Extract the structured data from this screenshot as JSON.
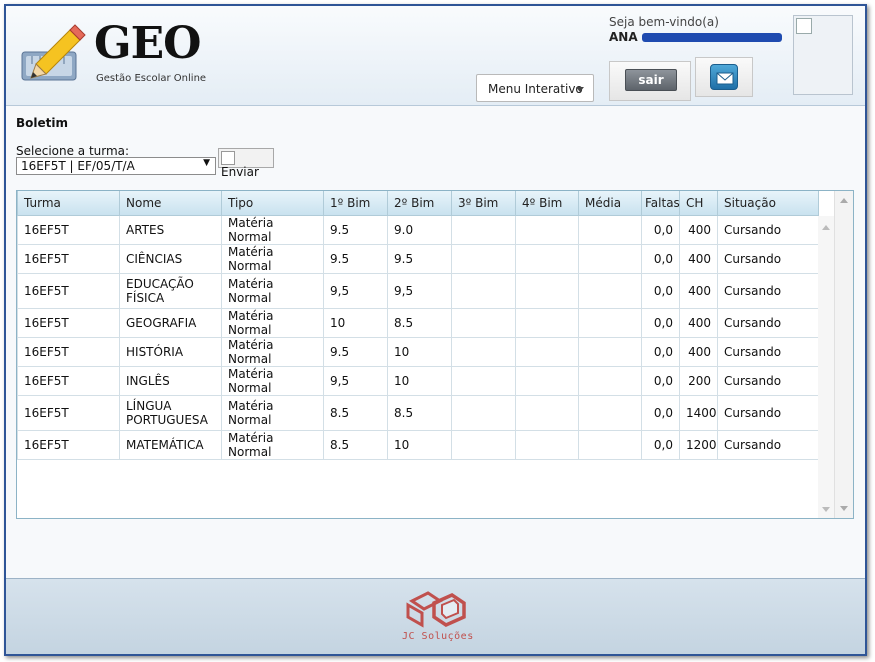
{
  "header": {
    "logo_title": "GEO",
    "logo_subtitle": "Gestão Escolar Online",
    "welcome": "Seja bem-vindo(a)",
    "user_first_name": "ANA",
    "menu_label": "Menu Interativo",
    "logout_label": "sair"
  },
  "boletim": {
    "title": "Boletim",
    "select_label": "Selecione a turma:",
    "selected_turma": "16EF5T | EF/05/T/A",
    "submit_label": "Enviar"
  },
  "table": {
    "columns": [
      "Turma",
      "Nome",
      "Tipo",
      "1º Bim",
      "2º Bim",
      "3º Bim",
      "4º Bim",
      "Média",
      "Faltas",
      "CH",
      "Situação"
    ],
    "rows": [
      {
        "turma": "16EF5T",
        "nome": "ARTES",
        "tipo": "Matéria Normal",
        "b1": "9.5",
        "b2": "9.0",
        "b3": "",
        "b4": "",
        "media": "",
        "faltas": "0,0",
        "ch": "400",
        "situacao": "Cursando"
      },
      {
        "turma": "16EF5T",
        "nome": "CIÊNCIAS",
        "tipo": "Matéria Normal",
        "b1": "9.5",
        "b2": "9.5",
        "b3": "",
        "b4": "",
        "media": "",
        "faltas": "0,0",
        "ch": "400",
        "situacao": "Cursando"
      },
      {
        "turma": "16EF5T",
        "nome": "EDUCAÇÃO FÍSICA",
        "tipo": "Matéria Normal",
        "b1": "9,5",
        "b2": "9,5",
        "b3": "",
        "b4": "",
        "media": "",
        "faltas": "0,0",
        "ch": "400",
        "situacao": "Cursando"
      },
      {
        "turma": "16EF5T",
        "nome": "GEOGRAFIA",
        "tipo": "Matéria Normal",
        "b1": "10",
        "b2": "8.5",
        "b3": "",
        "b4": "",
        "media": "",
        "faltas": "0,0",
        "ch": "400",
        "situacao": "Cursando"
      },
      {
        "turma": "16EF5T",
        "nome": "HISTÓRIA",
        "tipo": "Matéria Normal",
        "b1": "9.5",
        "b2": "10",
        "b3": "",
        "b4": "",
        "media": "",
        "faltas": "0,0",
        "ch": "400",
        "situacao": "Cursando"
      },
      {
        "turma": "16EF5T",
        "nome": "INGLÊS",
        "tipo": "Matéria Normal",
        "b1": "9,5",
        "b2": "10",
        "b3": "",
        "b4": "",
        "media": "",
        "faltas": "0,0",
        "ch": "200",
        "situacao": "Cursando"
      },
      {
        "turma": "16EF5T",
        "nome": "LÍNGUA PORTUGUESA",
        "tipo": "Matéria Normal",
        "b1": "8.5",
        "b2": "8.5",
        "b3": "",
        "b4": "",
        "media": "",
        "faltas": "0,0",
        "ch": "1400",
        "situacao": "Cursando"
      },
      {
        "turma": "16EF5T",
        "nome": "MATEMÁTICA",
        "tipo": "Matéria Normal",
        "b1": "8.5",
        "b2": "10",
        "b3": "",
        "b4": "",
        "media": "",
        "faltas": "0,0",
        "ch": "1200",
        "situacao": "Cursando"
      }
    ]
  },
  "footer": {
    "brand": "JC Soluções"
  },
  "icons": [
    "pencil-logo-icon",
    "mail-icon",
    "broken-image-icon",
    "dropdown-caret-icon",
    "jc-logo-icon"
  ],
  "colors": {
    "frame_border": "#2f5597",
    "header_gradient_end": "#e4edf5",
    "table_header": "#c9e2ef",
    "footer_bg": "#c4d4e1",
    "brand_red": "#c0504d"
  }
}
